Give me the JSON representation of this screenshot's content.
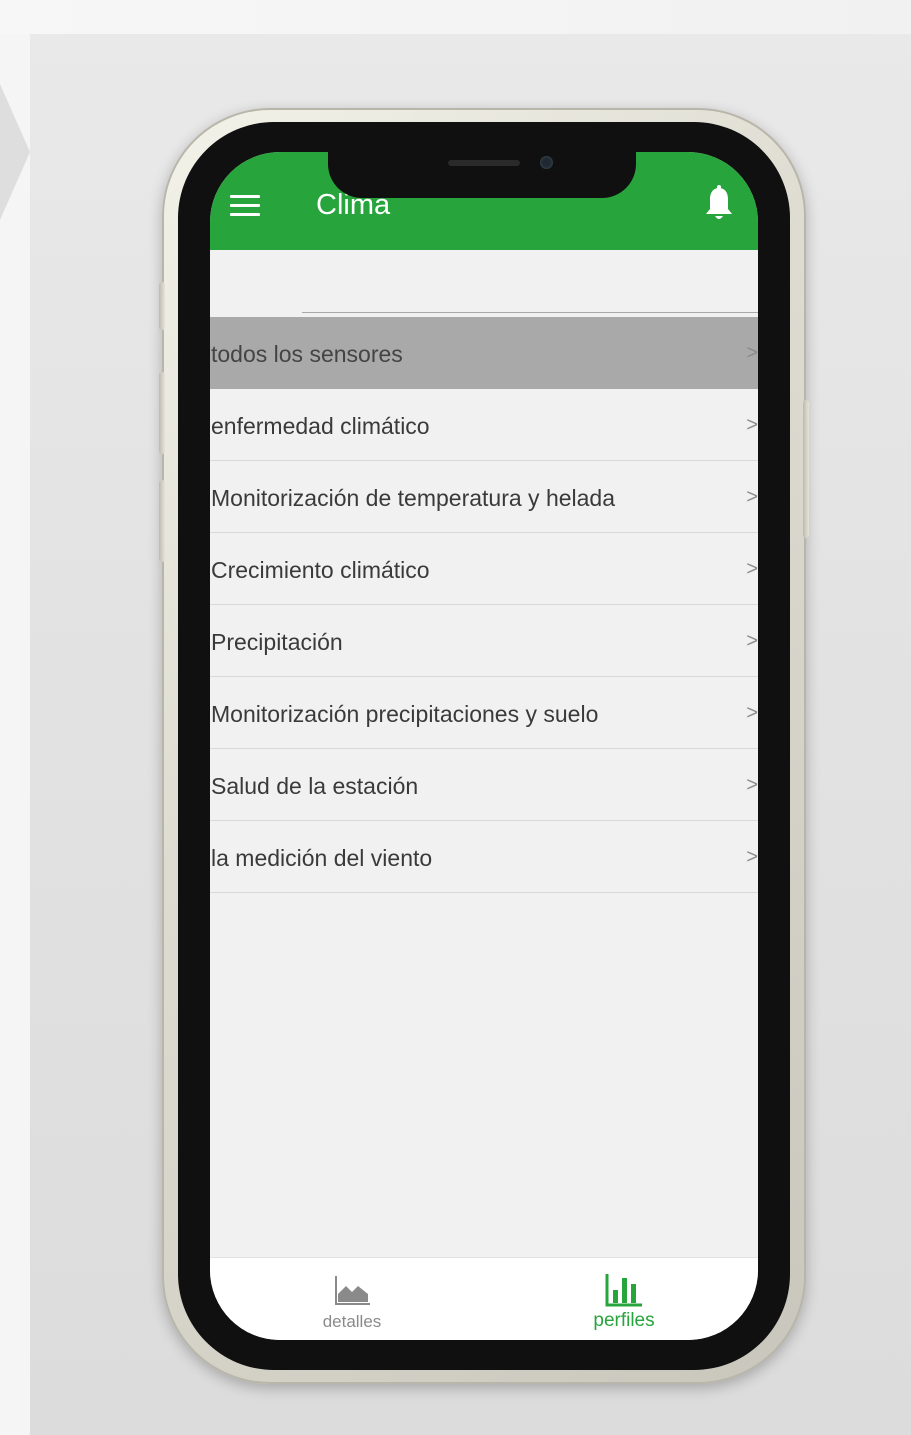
{
  "app_bar": {
    "title": "Clima",
    "menu_icon": "hamburger-menu-icon",
    "bell_icon": "bell-icon",
    "color": "#27a43b"
  },
  "list": {
    "items": [
      {
        "label": "todos los sensores",
        "chevron": ">",
        "selected": true
      },
      {
        "label": "enfermedad climático",
        "chevron": ">"
      },
      {
        "label": "Monitorización de temperatura y helada",
        "chevron": ">"
      },
      {
        "label": "Crecimiento climático",
        "chevron": ">"
      },
      {
        "label": "Precipitación",
        "chevron": ">"
      },
      {
        "label": "Monitorización precipitaciones y suelo",
        "chevron": ">"
      },
      {
        "label": "Salud de la estación",
        "chevron": ">"
      },
      {
        "label": "la medición del viento",
        "chevron": ">"
      }
    ]
  },
  "bottom_nav": {
    "items": [
      {
        "label": "detalles",
        "icon": "area-chart-icon",
        "active": false
      },
      {
        "label": "perfiles",
        "icon": "bar-chart-icon",
        "active": true
      }
    ]
  },
  "colors": {
    "accent": "#27a43b",
    "selected_row": "#a9a9a9",
    "inactive_nav": "#8a8a8a"
  }
}
